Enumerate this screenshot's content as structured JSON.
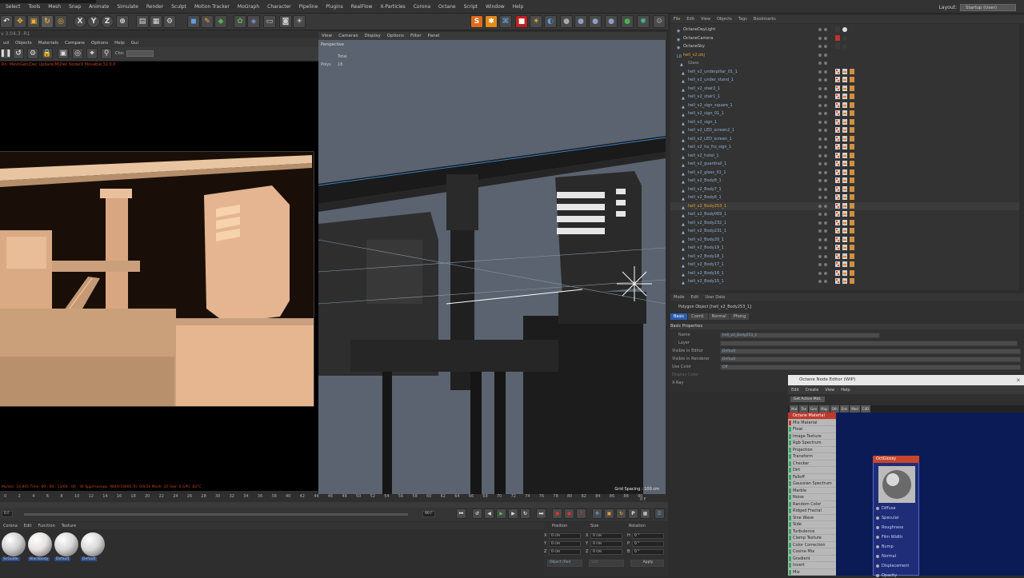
{
  "menubar": {
    "items": [
      "Select",
      "Tools",
      "Mesh",
      "Snap",
      "Animate",
      "Simulate",
      "Render",
      "Sculpt",
      "Motion Tracker",
      "MoGraph",
      "Character",
      "Pipeline",
      "Plugins",
      "RealFlow",
      "X-Particles",
      "Corona",
      "Octane",
      "Script",
      "Window",
      "Help"
    ],
    "layout_label": "Layout:",
    "layout_value": "Startup (User)"
  },
  "toolbar": {
    "axis_x": "X",
    "axis_y": "Y",
    "axis_z": "Z"
  },
  "left_viewport": {
    "version": "v 3.04.3 -R1",
    "menu": [
      "ud",
      "Objects",
      "Materials",
      "Compare",
      "Options",
      "Help",
      "Gui"
    ],
    "channel_label": "Chn:",
    "status": "Rn: MeshGen(Dec Update(M)Dec Node(0 Movable:32  0.0",
    "bottom_status": "Ms/sec: 14.845   Time: 00 : 00 : 13/00 : 00 : 30   Spp/maxspp: 9840/16000   Tri: 0/0/2k   Mesh: 32   Hair: 0     GPU:   82°C"
  },
  "main_viewport": {
    "menu": [
      "View",
      "Cameras",
      "Display",
      "Options",
      "Filter",
      "Panel"
    ],
    "camera": "Perspective",
    "label_total": "Total",
    "label_polys": "Polys",
    "polys_value": "18",
    "grid_spacing": "Grid Spacing : 100 cm"
  },
  "object_manager": {
    "menu": [
      "File",
      "Edit",
      "View",
      "Objects",
      "Tags",
      "Bookmarks"
    ],
    "objects": [
      {
        "name": "OctaneDayLight",
        "color": "#c8c8c8"
      },
      {
        "name": "OctaneCamera",
        "color": "#c8c8c8"
      },
      {
        "name": "OctaneSky",
        "color": "#c8c8c8"
      },
      {
        "name": "hell_v2.obj",
        "color": "#e0a030"
      },
      {
        "name": "Glass",
        "color": "#9e9e9e"
      },
      {
        "name": "hell_v2_underpillar_01_1",
        "color": "#8fb0d5"
      },
      {
        "name": "hell_v2_under_stand_1",
        "color": "#8fb0d5"
      },
      {
        "name": "hell_v2_stair2_1",
        "color": "#8fb0d5"
      },
      {
        "name": "hell_v2_stair1_1",
        "color": "#8fb0d5"
      },
      {
        "name": "hell_v2_sign_square_1",
        "color": "#8fb0d5"
      },
      {
        "name": "hell_v2_sign_01_1",
        "color": "#8fb0d5"
      },
      {
        "name": "hell_v2_sign_1",
        "color": "#8fb0d5"
      },
      {
        "name": "hell_v2_LED_screen2_1",
        "color": "#8fb0d5"
      },
      {
        "name": "hell_v2_LED_screen_1",
        "color": "#8fb0d5"
      },
      {
        "name": "hell_v2_ho_fro_sign_1",
        "color": "#8fb0d5"
      },
      {
        "name": "hell_v2_hotel_1",
        "color": "#8fb0d5"
      },
      {
        "name": "hell_v2_guardrail_1",
        "color": "#8fb0d5"
      },
      {
        "name": "hell_v2_glass_01_1",
        "color": "#8fb0d5"
      },
      {
        "name": "hell_v2_Body8_1",
        "color": "#8fb0d5"
      },
      {
        "name": "hell_v2_Body7_1",
        "color": "#8fb0d5"
      },
      {
        "name": "hell_v2_Body6_1",
        "color": "#8fb0d5"
      },
      {
        "name": "hell_v2_Body253_1",
        "color": "#e0a030"
      },
      {
        "name": "hell_v2_Body069_1",
        "color": "#8fb0d5"
      },
      {
        "name": "hell_v2_Body232_1",
        "color": "#8fb0d5"
      },
      {
        "name": "hell_v2_Body231_1",
        "color": "#8fb0d5"
      },
      {
        "name": "hell_v2_Body20_1",
        "color": "#8fb0d5"
      },
      {
        "name": "hell_v2_Body19_1",
        "color": "#8fb0d5"
      },
      {
        "name": "hell_v2_Body18_1",
        "color": "#8fb0d5"
      },
      {
        "name": "hell_v2_Body17_1",
        "color": "#8fb0d5"
      },
      {
        "name": "hell_v2_Body16_1",
        "color": "#8fb0d5"
      },
      {
        "name": "hell_v2_Body15_1",
        "color": "#8fb0d5"
      }
    ]
  },
  "attributes": {
    "menu": [
      "Mode",
      "Edit",
      "User Data"
    ],
    "object_title": "Polygon Object [hell_v2_Body253_1]",
    "tabs": [
      "Basic",
      "Coord.",
      "Normal",
      "Phong"
    ],
    "section": "Basic Properties",
    "name_label": "Name",
    "name_value": "hell_v2_Body253_1",
    "layer_label": "Layer",
    "vis_editor_label": "Visible in Editor",
    "vis_editor_value": "Default",
    "vis_render_label": "Visible in Renderer",
    "vis_render_value": "Default",
    "use_color_label": "Use Color",
    "use_color_value": "Off",
    "display_color_label": "Display Color",
    "xray_label": "X-Ray"
  },
  "node_editor": {
    "title": "Octane Node Editor (WIP)",
    "menu": [
      "Edit",
      "Create",
      "View",
      "Help"
    ],
    "get_active": "Get Active Mat.",
    "tabs": [
      "Mat",
      "Tex",
      "Gen",
      "Map",
      "Oth",
      "Emi",
      "Med",
      "C4D"
    ],
    "node_types": [
      {
        "name": "Octane Material",
        "color": "#c0392b"
      },
      {
        "name": "Mix Material",
        "color": "#c0392b"
      },
      {
        "name": "Float",
        "color": "#27ae60"
      },
      {
        "name": "Image Texture",
        "color": "#27ae60"
      },
      {
        "name": "Rgb Spectrum",
        "color": "#27ae60"
      },
      {
        "name": "Projection",
        "color": "#27ae60"
      },
      {
        "name": "Transform",
        "color": "#27ae60"
      },
      {
        "name": "Checker",
        "color": "#27ae60"
      },
      {
        "name": "Dirt",
        "color": "#27ae60"
      },
      {
        "name": "Falloff",
        "color": "#27ae60"
      },
      {
        "name": "Gaussian Spectrum",
        "color": "#27ae60"
      },
      {
        "name": "Marble",
        "color": "#27ae60"
      },
      {
        "name": "Noise",
        "color": "#27ae60"
      },
      {
        "name": "Random Color",
        "color": "#27ae60"
      },
      {
        "name": "Ridged Fractal",
        "color": "#27ae60"
      },
      {
        "name": "Sine Wave",
        "color": "#27ae60"
      },
      {
        "name": "Side",
        "color": "#27ae60"
      },
      {
        "name": "Turbulence",
        "color": "#27ae60"
      },
      {
        "name": "Clamp Texture",
        "color": "#27ae60"
      },
      {
        "name": "Color Correction",
        "color": "#27ae60"
      },
      {
        "name": "Cosine Mix",
        "color": "#27ae60"
      },
      {
        "name": "Gradient",
        "color": "#27ae60"
      },
      {
        "name": "Invert",
        "color": "#27ae60"
      },
      {
        "name": "Mix",
        "color": "#27ae60"
      }
    ],
    "node_title": "OctGlossy",
    "pins": [
      "Diffuse",
      "Specular",
      "Roughness",
      "Film Width",
      "Bump",
      "Normal",
      "Displacement",
      "Opacity"
    ]
  },
  "timeline": {
    "ticks": [
      "0",
      "2",
      "4",
      "6",
      "8",
      "10",
      "12",
      "14",
      "16",
      "18",
      "20",
      "22",
      "24",
      "26",
      "28",
      "30",
      "32",
      "34",
      "36",
      "38",
      "40",
      "42",
      "44",
      "46",
      "48",
      "50",
      "52",
      "54",
      "56",
      "58",
      "60",
      "62",
      "64",
      "66",
      "68",
      "70",
      "72",
      "74",
      "76",
      "78",
      "80",
      "82",
      "84",
      "86",
      "88",
      "90"
    ],
    "end_frame": "0 F",
    "start_field": "0 F",
    "end_field": "90 F"
  },
  "materials": {
    "menu": [
      "Corona",
      "Edit",
      "Function",
      "Texture"
    ],
    "items": [
      {
        "label": "ScGuide",
        "color": "#cfcfcf"
      },
      {
        "label": "Blackbody",
        "color": "#e8e0e0"
      },
      {
        "label": "Default",
        "color": "#d8d8d8"
      },
      {
        "label": "Default",
        "color": "#d8d8d8"
      }
    ]
  },
  "coordinates": {
    "headers": [
      "Position",
      "Size",
      "Rotation"
    ],
    "rows": [
      {
        "axis": "X",
        "pos": "0 cm",
        "size_axis": "X",
        "size": "0 cm",
        "rot_axis": "H",
        "rot": "0 °"
      },
      {
        "axis": "Y",
        "pos": "0 cm",
        "size_axis": "Y",
        "size": "0 cm",
        "rot_axis": "P",
        "rot": "0 °"
      },
      {
        "axis": "Z",
        "pos": "0 cm",
        "size_axis": "Z",
        "size": "0 cm",
        "rot_axis": "B",
        "rot": "0 °"
      }
    ],
    "mode": "Object (Rel)",
    "size_mode": "Size",
    "apply": "Apply"
  }
}
